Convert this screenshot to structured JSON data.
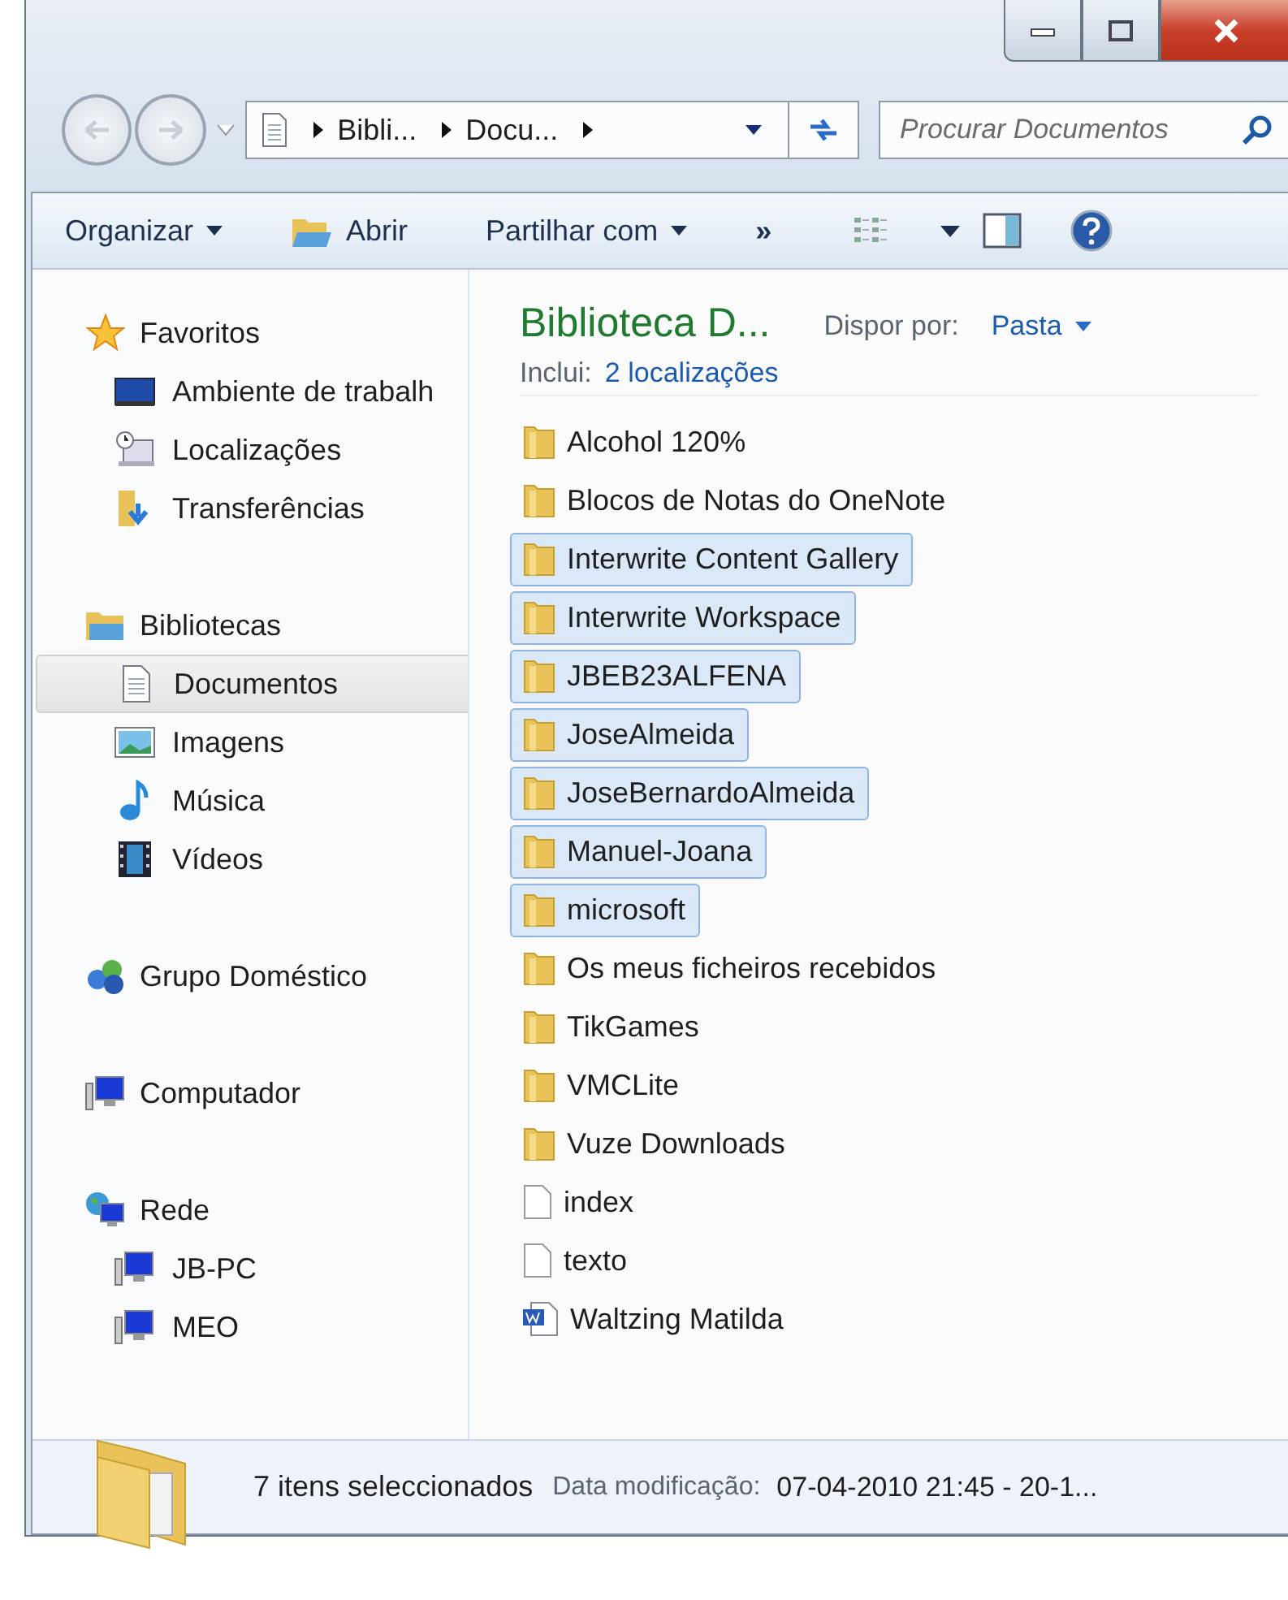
{
  "breadcrumb": [
    "Bibli...",
    "Docu..."
  ],
  "search": {
    "placeholder": "Procurar Documentos"
  },
  "toolbar": [
    {
      "label": "Organizar",
      "kind": "menu"
    },
    {
      "label": "Abrir",
      "kind": "open"
    },
    {
      "label": "Partilhar com",
      "kind": "menu"
    },
    {
      "label": "»",
      "kind": "more"
    }
  ],
  "sidebar": {
    "groups": [
      {
        "label": "Favoritos",
        "kind": "star",
        "children": [
          {
            "label": "Ambiente de trabalh",
            "kind": "desktop",
            "selected": false
          },
          {
            "label": "Localizações",
            "kind": "places",
            "selected": false
          },
          {
            "label": "Transferências",
            "kind": "download",
            "selected": false
          }
        ]
      },
      {
        "label": "Bibliotecas",
        "kind": "library",
        "children": [
          {
            "label": "Documentos",
            "kind": "document",
            "selected": true
          },
          {
            "label": "Imagens",
            "kind": "pictures",
            "selected": false
          },
          {
            "label": "Música",
            "kind": "music",
            "selected": false
          },
          {
            "label": "Vídeos",
            "kind": "video",
            "selected": false
          }
        ]
      },
      {
        "label": "Grupo Doméstico",
        "kind": "homegroup"
      },
      {
        "label": "Computador",
        "kind": "computer"
      },
      {
        "label": "Rede",
        "kind": "network",
        "children": [
          {
            "label": "JB-PC",
            "kind": "computer",
            "selected": false
          },
          {
            "label": "MEO",
            "kind": "computer",
            "selected": false
          }
        ]
      }
    ]
  },
  "library": {
    "title": "Biblioteca D...",
    "includes_label": "Inclui:",
    "includes_link": "2 localizações",
    "arrange_label": "Dispor por:",
    "arrange_value": "Pasta"
  },
  "files": [
    {
      "name": "Alcohol 120%",
      "kind": "folder",
      "selected": false
    },
    {
      "name": "Blocos de Notas do OneNote",
      "kind": "folder",
      "selected": false
    },
    {
      "name": "Interwrite Content Gallery",
      "kind": "folder",
      "selected": true
    },
    {
      "name": "Interwrite Workspace",
      "kind": "folder",
      "selected": true
    },
    {
      "name": "JBEB23ALFENA",
      "kind": "folder",
      "selected": true
    },
    {
      "name": "JoseAlmeida",
      "kind": "folder",
      "selected": true
    },
    {
      "name": "JoseBernardoAlmeida",
      "kind": "folder",
      "selected": true
    },
    {
      "name": "Manuel-Joana",
      "kind": "folder",
      "selected": true
    },
    {
      "name": "microsoft",
      "kind": "folder",
      "selected": true
    },
    {
      "name": "Os meus ficheiros recebidos",
      "kind": "folder",
      "selected": false
    },
    {
      "name": "TikGames",
      "kind": "folder",
      "selected": false
    },
    {
      "name": "VMCLite",
      "kind": "folder",
      "selected": false
    },
    {
      "name": "Vuze Downloads",
      "kind": "folder",
      "selected": false
    },
    {
      "name": "index",
      "kind": "file",
      "selected": false
    },
    {
      "name": "texto",
      "kind": "file",
      "selected": false
    },
    {
      "name": "Waltzing Matilda",
      "kind": "word",
      "selected": false
    }
  ],
  "status_bar": {
    "count": "7 itens seleccionados",
    "date_label": "Data modificação:",
    "date_value": "07-04-2010 21:45 - 20-1..."
  }
}
